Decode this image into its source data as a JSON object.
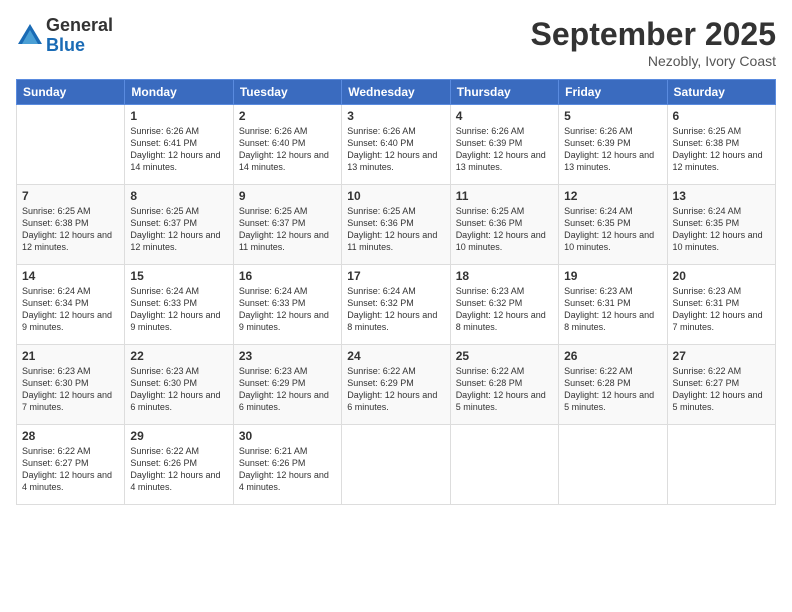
{
  "logo": {
    "general": "General",
    "blue": "Blue"
  },
  "title": "September 2025",
  "location": "Nezobly, Ivory Coast",
  "days_header": [
    "Sunday",
    "Monday",
    "Tuesday",
    "Wednesday",
    "Thursday",
    "Friday",
    "Saturday"
  ],
  "weeks": [
    [
      {
        "day": "",
        "sunrise": "",
        "sunset": "",
        "daylight": ""
      },
      {
        "day": "1",
        "sunrise": "Sunrise: 6:26 AM",
        "sunset": "Sunset: 6:41 PM",
        "daylight": "Daylight: 12 hours and 14 minutes."
      },
      {
        "day": "2",
        "sunrise": "Sunrise: 6:26 AM",
        "sunset": "Sunset: 6:40 PM",
        "daylight": "Daylight: 12 hours and 14 minutes."
      },
      {
        "day": "3",
        "sunrise": "Sunrise: 6:26 AM",
        "sunset": "Sunset: 6:40 PM",
        "daylight": "Daylight: 12 hours and 13 minutes."
      },
      {
        "day": "4",
        "sunrise": "Sunrise: 6:26 AM",
        "sunset": "Sunset: 6:39 PM",
        "daylight": "Daylight: 12 hours and 13 minutes."
      },
      {
        "day": "5",
        "sunrise": "Sunrise: 6:26 AM",
        "sunset": "Sunset: 6:39 PM",
        "daylight": "Daylight: 12 hours and 13 minutes."
      },
      {
        "day": "6",
        "sunrise": "Sunrise: 6:25 AM",
        "sunset": "Sunset: 6:38 PM",
        "daylight": "Daylight: 12 hours and 12 minutes."
      }
    ],
    [
      {
        "day": "7",
        "sunrise": "Sunrise: 6:25 AM",
        "sunset": "Sunset: 6:38 PM",
        "daylight": "Daylight: 12 hours and 12 minutes."
      },
      {
        "day": "8",
        "sunrise": "Sunrise: 6:25 AM",
        "sunset": "Sunset: 6:37 PM",
        "daylight": "Daylight: 12 hours and 12 minutes."
      },
      {
        "day": "9",
        "sunrise": "Sunrise: 6:25 AM",
        "sunset": "Sunset: 6:37 PM",
        "daylight": "Daylight: 12 hours and 11 minutes."
      },
      {
        "day": "10",
        "sunrise": "Sunrise: 6:25 AM",
        "sunset": "Sunset: 6:36 PM",
        "daylight": "Daylight: 12 hours and 11 minutes."
      },
      {
        "day": "11",
        "sunrise": "Sunrise: 6:25 AM",
        "sunset": "Sunset: 6:36 PM",
        "daylight": "Daylight: 12 hours and 10 minutes."
      },
      {
        "day": "12",
        "sunrise": "Sunrise: 6:24 AM",
        "sunset": "Sunset: 6:35 PM",
        "daylight": "Daylight: 12 hours and 10 minutes."
      },
      {
        "day": "13",
        "sunrise": "Sunrise: 6:24 AM",
        "sunset": "Sunset: 6:35 PM",
        "daylight": "Daylight: 12 hours and 10 minutes."
      }
    ],
    [
      {
        "day": "14",
        "sunrise": "Sunrise: 6:24 AM",
        "sunset": "Sunset: 6:34 PM",
        "daylight": "Daylight: 12 hours and 9 minutes."
      },
      {
        "day": "15",
        "sunrise": "Sunrise: 6:24 AM",
        "sunset": "Sunset: 6:33 PM",
        "daylight": "Daylight: 12 hours and 9 minutes."
      },
      {
        "day": "16",
        "sunrise": "Sunrise: 6:24 AM",
        "sunset": "Sunset: 6:33 PM",
        "daylight": "Daylight: 12 hours and 9 minutes."
      },
      {
        "day": "17",
        "sunrise": "Sunrise: 6:24 AM",
        "sunset": "Sunset: 6:32 PM",
        "daylight": "Daylight: 12 hours and 8 minutes."
      },
      {
        "day": "18",
        "sunrise": "Sunrise: 6:23 AM",
        "sunset": "Sunset: 6:32 PM",
        "daylight": "Daylight: 12 hours and 8 minutes."
      },
      {
        "day": "19",
        "sunrise": "Sunrise: 6:23 AM",
        "sunset": "Sunset: 6:31 PM",
        "daylight": "Daylight: 12 hours and 8 minutes."
      },
      {
        "day": "20",
        "sunrise": "Sunrise: 6:23 AM",
        "sunset": "Sunset: 6:31 PM",
        "daylight": "Daylight: 12 hours and 7 minutes."
      }
    ],
    [
      {
        "day": "21",
        "sunrise": "Sunrise: 6:23 AM",
        "sunset": "Sunset: 6:30 PM",
        "daylight": "Daylight: 12 hours and 7 minutes."
      },
      {
        "day": "22",
        "sunrise": "Sunrise: 6:23 AM",
        "sunset": "Sunset: 6:30 PM",
        "daylight": "Daylight: 12 hours and 6 minutes."
      },
      {
        "day": "23",
        "sunrise": "Sunrise: 6:23 AM",
        "sunset": "Sunset: 6:29 PM",
        "daylight": "Daylight: 12 hours and 6 minutes."
      },
      {
        "day": "24",
        "sunrise": "Sunrise: 6:22 AM",
        "sunset": "Sunset: 6:29 PM",
        "daylight": "Daylight: 12 hours and 6 minutes."
      },
      {
        "day": "25",
        "sunrise": "Sunrise: 6:22 AM",
        "sunset": "Sunset: 6:28 PM",
        "daylight": "Daylight: 12 hours and 5 minutes."
      },
      {
        "day": "26",
        "sunrise": "Sunrise: 6:22 AM",
        "sunset": "Sunset: 6:28 PM",
        "daylight": "Daylight: 12 hours and 5 minutes."
      },
      {
        "day": "27",
        "sunrise": "Sunrise: 6:22 AM",
        "sunset": "Sunset: 6:27 PM",
        "daylight": "Daylight: 12 hours and 5 minutes."
      }
    ],
    [
      {
        "day": "28",
        "sunrise": "Sunrise: 6:22 AM",
        "sunset": "Sunset: 6:27 PM",
        "daylight": "Daylight: 12 hours and 4 minutes."
      },
      {
        "day": "29",
        "sunrise": "Sunrise: 6:22 AM",
        "sunset": "Sunset: 6:26 PM",
        "daylight": "Daylight: 12 hours and 4 minutes."
      },
      {
        "day": "30",
        "sunrise": "Sunrise: 6:21 AM",
        "sunset": "Sunset: 6:26 PM",
        "daylight": "Daylight: 12 hours and 4 minutes."
      },
      {
        "day": "",
        "sunrise": "",
        "sunset": "",
        "daylight": ""
      },
      {
        "day": "",
        "sunrise": "",
        "sunset": "",
        "daylight": ""
      },
      {
        "day": "",
        "sunrise": "",
        "sunset": "",
        "daylight": ""
      },
      {
        "day": "",
        "sunrise": "",
        "sunset": "",
        "daylight": ""
      }
    ]
  ]
}
